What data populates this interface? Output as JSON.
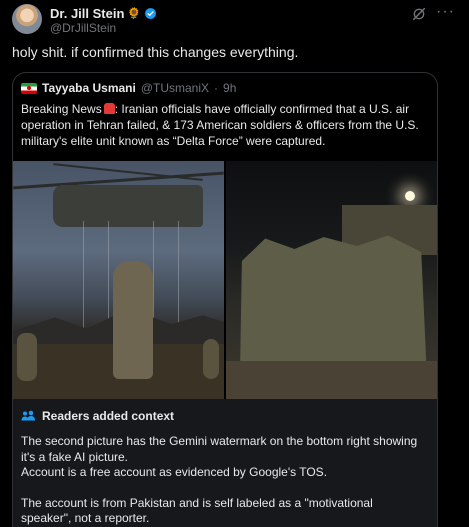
{
  "post": {
    "author_name": "Dr. Jill Stein",
    "author_emoji": "🌻",
    "handle": "@DrJillStein",
    "text": "holy shit. if confirmed this changes everything.",
    "more_label": "···"
  },
  "quote": {
    "author_name": "Tayyaba Usmani",
    "handle": "@TUsmaniX",
    "separator": "·",
    "time": "9h",
    "text_before": "Breaking News",
    "text_after": ": Iranian officials have officially confirmed that a U.S. air operation in Tehran failed, & 173 American soldiers & officers from the U.S. military's elite unit known as “Delta Force” were captured."
  },
  "context": {
    "title": "Readers added context",
    "paragraph_1_line_1": "The second picture has the Gemini watermark on the bottom right showing it's a fake AI picture.",
    "paragraph_1_line_2": "Account is a free account as evidenced by Google's TOS.",
    "paragraph_2": "The account is from Pakistan and is self labeled as a \"motivational speaker\", not a reporter."
  },
  "colors": {
    "background": "#000000",
    "text": "#e7e9ea",
    "muted": "#71767b",
    "verified": "#1d9bf0",
    "context_bg": "#16181c",
    "context_icon": "#1d9bf0"
  },
  "icons": {
    "verified": "verified-badge-icon",
    "grok": "grok-icon",
    "more": "more-icon",
    "flag": "iran-flag-icon",
    "siren": "siren-icon",
    "readers": "people-icon"
  }
}
